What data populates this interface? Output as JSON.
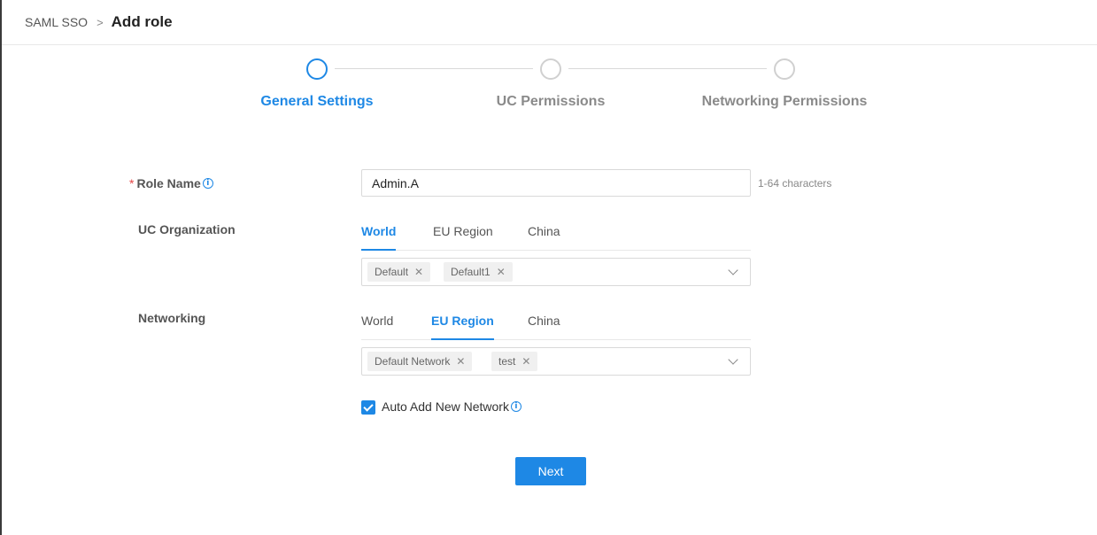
{
  "breadcrumb": {
    "parent": "SAML SSO",
    "separator": ">",
    "current": "Add role"
  },
  "steps": [
    {
      "label": "General Settings",
      "active": true
    },
    {
      "label": "UC Permissions",
      "active": false
    },
    {
      "label": "Networking Permissions",
      "active": false
    }
  ],
  "form": {
    "role_name": {
      "required_mark": "*",
      "label": "Role Name",
      "info_icon": "info-circle-icon",
      "value": "Admin.A",
      "hint": "1-64 characters"
    },
    "uc_organization": {
      "label": "UC Organization",
      "tabs": [
        "World",
        "EU Region",
        "China"
      ],
      "active_tab": "World",
      "selected_tags": [
        "Default",
        "Default1"
      ]
    },
    "networking": {
      "label": "Networking",
      "tabs": [
        "World",
        "EU Region",
        "China"
      ],
      "active_tab": "EU Region",
      "selected_tags": [
        "Default Network",
        "test"
      ]
    },
    "auto_add": {
      "label": "Auto Add New Network",
      "checked": true,
      "info_icon": "info-circle-icon"
    }
  },
  "actions": {
    "next_label": "Next"
  },
  "colors": {
    "accent": "#1e88e5",
    "required": "#e54545",
    "muted": "#8a8a8a"
  }
}
